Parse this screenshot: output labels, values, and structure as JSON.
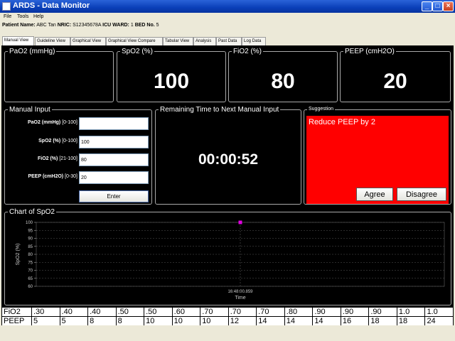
{
  "window": {
    "title": "ARDS - Data Monitor"
  },
  "menu": [
    "File",
    "Tools",
    "Help"
  ],
  "patient": {
    "name_label": "Patient Name:",
    "name": "ABC Tan",
    "nric_label": "NRIC:",
    "nric": "S12345678A",
    "ward_label": "ICU WARD:",
    "ward": "1",
    "bed_label": "BED No.",
    "bed": "5"
  },
  "tabs": [
    "Manual View",
    "Guideline View",
    "Graphical View",
    "Graphical View Compare",
    "Tabular View",
    "Analysis",
    "Past Data",
    "Log Data"
  ],
  "readouts": [
    {
      "label": "PaO2 (mmHg)",
      "value": ""
    },
    {
      "label": "SpO2 (%)",
      "value": "100"
    },
    {
      "label": "FiO2 (%)",
      "value": "80"
    },
    {
      "label": "PEEP (cmH2O)",
      "value": "20"
    }
  ],
  "manual_input": {
    "title": "Manual Input",
    "fields": [
      {
        "label": "PaO2 (mmHg)",
        "range": "[0-100]",
        "value": ""
      },
      {
        "label": "SpO2 (%)",
        "range": "[0-100]",
        "value": "100"
      },
      {
        "label": "FiO2 (%)",
        "range": "[21-100]",
        "value": "80"
      },
      {
        "label": "PEEP (cmH2O)",
        "range": "[0-30]",
        "value": "20"
      }
    ],
    "enter_label": "Enter"
  },
  "remaining": {
    "title": "Remaining Time to Next Manual Input",
    "time": "00:00:52"
  },
  "suggestion": {
    "title": "Suggestion",
    "text": "Reduce PEEP by 2",
    "agree_label": "Agree",
    "disagree_label": "Disagree",
    "background": "#ff0000"
  },
  "chart_data": {
    "type": "scatter",
    "title": "Chart of SpO2",
    "xlabel": "Time",
    "ylabel": "SpO2 (%)",
    "ylim": [
      60,
      100
    ],
    "y_ticks": [
      60,
      65,
      70,
      75,
      80,
      85,
      90,
      95,
      100
    ],
    "x_tick_labels": [
      "16:48:00.859"
    ],
    "grid": true,
    "series": [
      {
        "x": [
          "16:48:00.859"
        ],
        "y": [
          100
        ],
        "color": "#e000e0"
      }
    ]
  },
  "table": {
    "rows": [
      {
        "head": "FiO2",
        "cells": [
          ".30",
          ".40",
          ".40",
          ".50",
          ".50",
          ".60",
          ".70",
          ".70",
          ".70",
          ".80",
          ".90",
          ".90",
          ".90",
          "1.0",
          "1.0"
        ]
      },
      {
        "head": "PEEP",
        "cells": [
          "5",
          "5",
          "8",
          "8",
          "10",
          "10",
          "10",
          "12",
          "14",
          "14",
          "14",
          "16",
          "18",
          "18",
          "24"
        ]
      }
    ]
  }
}
